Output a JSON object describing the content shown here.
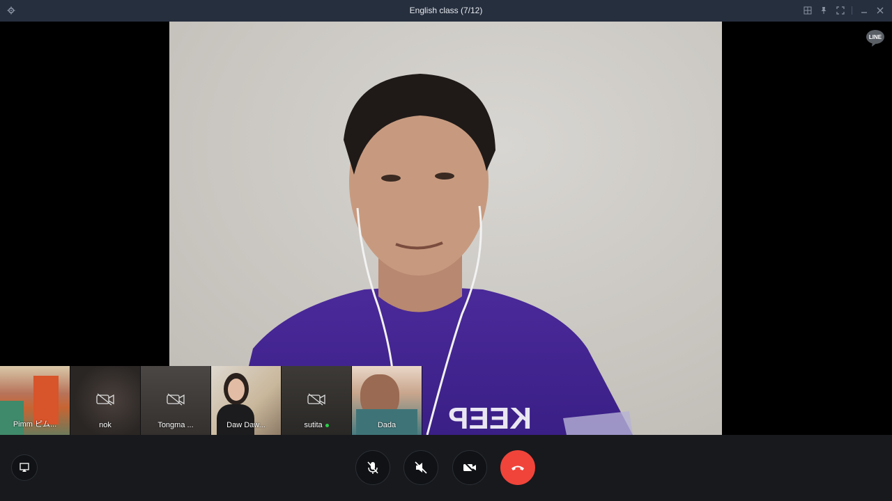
{
  "window": {
    "title": "English class (7/12)"
  },
  "participants": [
    {
      "name": "Pimm ピム...",
      "video": "on"
    },
    {
      "name": "nok",
      "video": "off"
    },
    {
      "name": "Tongma ...",
      "video": "off"
    },
    {
      "name": "Daw Daw...",
      "video": "on"
    },
    {
      "name": "sutita",
      "video": "off",
      "speaking": true
    },
    {
      "name": "Dada",
      "video": "on"
    }
  ],
  "main_video": {
    "shirt_text": "KEEP"
  },
  "brand": {
    "logo_text": "LINE"
  },
  "colors": {
    "titlebar": "#262f3e",
    "hangup": "#f0443a",
    "active_dot": "#2bd04a"
  }
}
